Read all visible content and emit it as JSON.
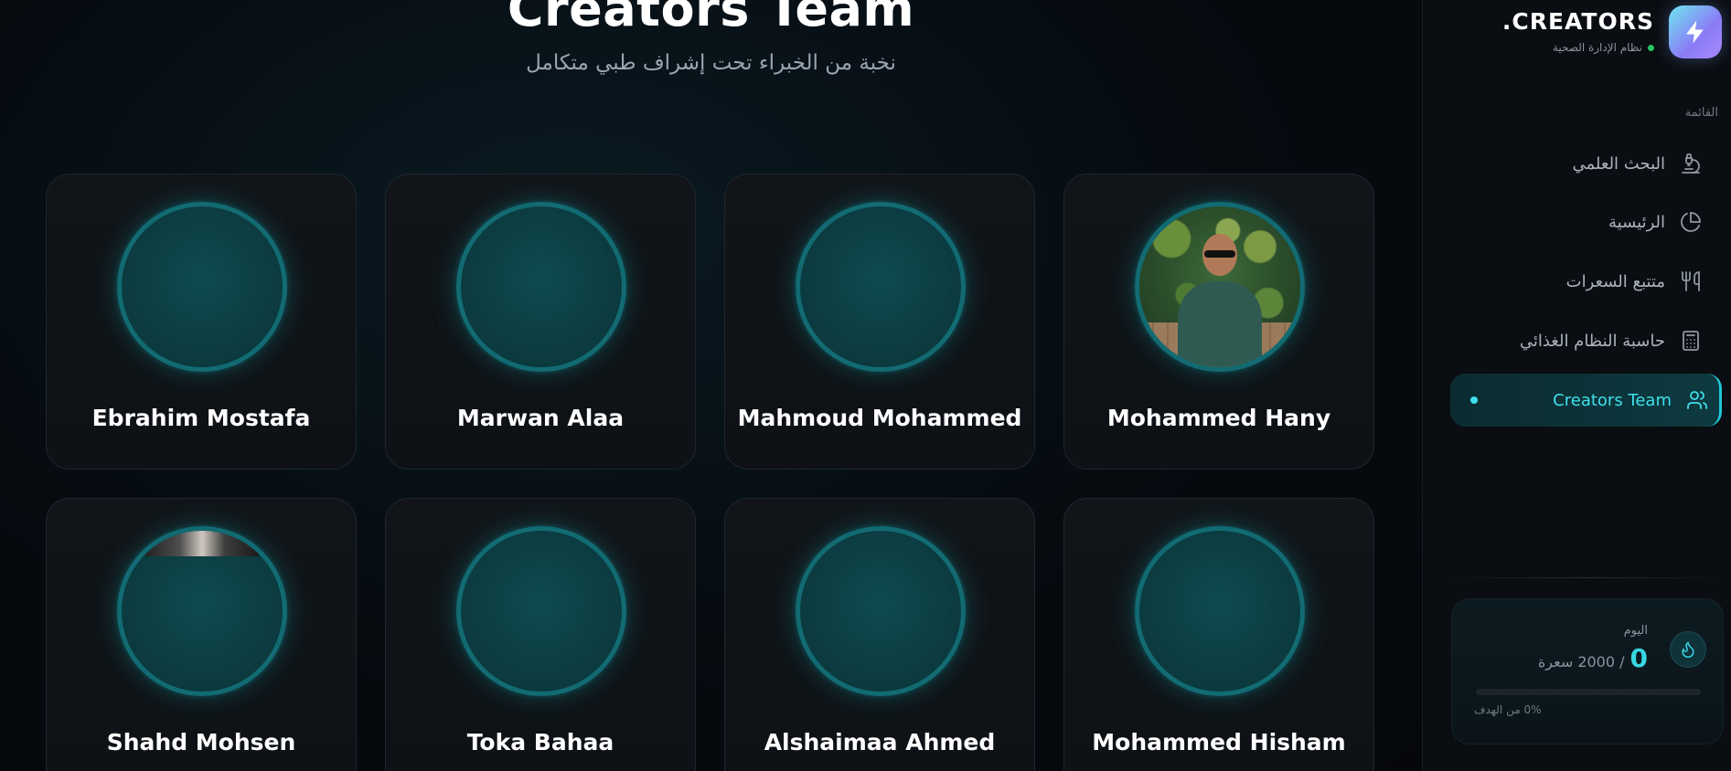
{
  "header": {
    "title": "Creators Team",
    "subtitle": "نخبة من الخبراء تحت إشراف طبي متكامل"
  },
  "members": [
    {
      "name": "Ebrahim Mostafa"
    },
    {
      "name": "Marwan Alaa"
    },
    {
      "name": "Mahmoud Mohammed"
    },
    {
      "name": "Mohammed Hany"
    },
    {
      "name": "Shahd Mohsen"
    },
    {
      "name": "Toka Bahaa"
    },
    {
      "name": "Alshaimaa Ahmed"
    },
    {
      "name": "Mohammed Hisham"
    }
  ],
  "sidebar": {
    "brand": ".CREATORS",
    "tagline": "نظام الإدارة الصحية",
    "menu_heading": "القائمة",
    "items": [
      {
        "label": "البحث العلمي",
        "icon": "microscope-icon"
      },
      {
        "label": "الرئيسية",
        "icon": "pie-chart-icon"
      },
      {
        "label": "متتبع السعرات",
        "icon": "utensils-icon"
      },
      {
        "label": "حاسبة النظام الغذائي",
        "icon": "calculator-icon"
      },
      {
        "label": "Creators Team",
        "icon": "users-icon"
      }
    ],
    "calories": {
      "today_label": "اليوم",
      "value": "0",
      "of": "/ 2000 سعرة",
      "progress": 0,
      "goal_text": "0% من الهدف"
    }
  },
  "colors": {
    "accent": "#38d6e3",
    "avatar_ring": "#126b73",
    "background": "#05080d"
  }
}
